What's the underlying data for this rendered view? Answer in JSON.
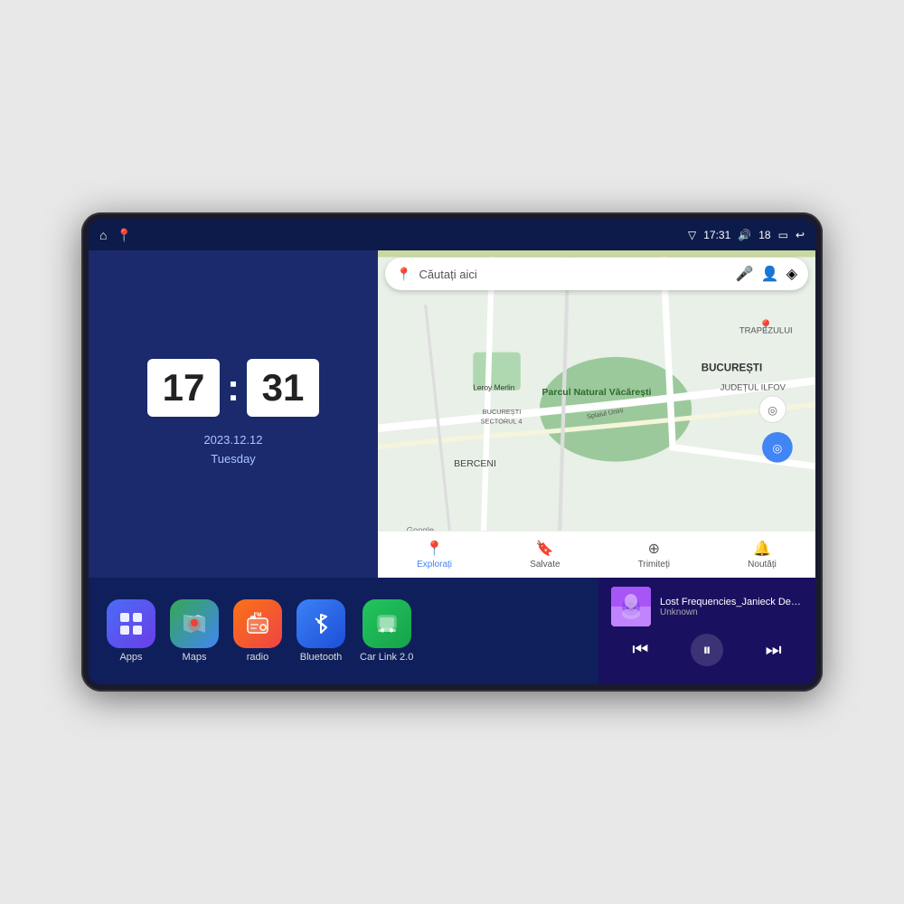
{
  "device": {
    "status_bar": {
      "signal_icon": "▽",
      "time": "17:31",
      "volume_icon": "🔊",
      "battery_level": "18",
      "battery_icon": "▭",
      "back_icon": "↩"
    },
    "clock": {
      "hours": "17",
      "minutes": "31",
      "date": "2023.12.12",
      "day": "Tuesday"
    },
    "map": {
      "search_placeholder": "Căutați aici",
      "location_names": [
        "Parcul Natural Văcărești",
        "BUCUREȘTI",
        "JUDEȚUL ILFOV",
        "BERCENI",
        "TRAPEZULUI",
        "Leroy Merlin",
        "BUCUREȘTI SECTORUL 4"
      ],
      "bottom_items": [
        {
          "label": "Explorați",
          "icon": "📍",
          "active": true
        },
        {
          "label": "Salvate",
          "icon": "🔖",
          "active": false
        },
        {
          "label": "Trimiteți",
          "icon": "⊕",
          "active": false
        },
        {
          "label": "Noutăți",
          "icon": "🔔",
          "active": false
        }
      ]
    },
    "apps": [
      {
        "id": "apps",
        "label": "Apps",
        "icon": "⊞",
        "color_class": "icon-apps"
      },
      {
        "id": "maps",
        "label": "Maps",
        "icon": "🗺",
        "color_class": "icon-maps"
      },
      {
        "id": "radio",
        "label": "radio",
        "icon": "📻",
        "color_class": "icon-radio"
      },
      {
        "id": "bluetooth",
        "label": "Bluetooth",
        "icon": "⛶",
        "color_class": "icon-bluetooth"
      },
      {
        "id": "carlink",
        "label": "Car Link 2.0",
        "icon": "📱",
        "color_class": "icon-carlink"
      }
    ],
    "music": {
      "title": "Lost Frequencies_Janieck Devy-...",
      "artist": "Unknown",
      "thumb_emoji": "🎵"
    }
  }
}
